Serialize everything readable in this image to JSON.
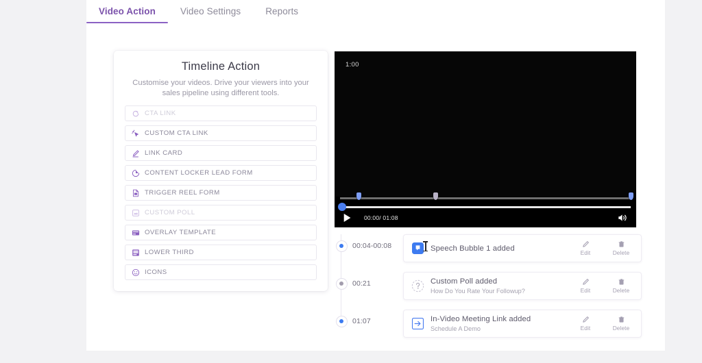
{
  "tabs": [
    {
      "label": "Video Action",
      "active": true
    },
    {
      "label": "Video Settings",
      "active": false
    },
    {
      "label": "Reports",
      "active": false
    }
  ],
  "timeline_card": {
    "title": "Timeline Action",
    "subtitle": "Customise your videos. Drive your viewers into your sales pipeline using different tools.",
    "actions": [
      {
        "label": "CTA LINK",
        "icon": "cta-link-icon",
        "dim": true
      },
      {
        "label": "CUSTOM CTA LINK",
        "icon": "custom-cta-link-icon",
        "dim": false
      },
      {
        "label": "LINK CARD",
        "icon": "link-card-icon",
        "dim": false
      },
      {
        "label": "CONTENT LOCKER LEAD FORM",
        "icon": "content-locker-icon",
        "dim": false
      },
      {
        "label": "TRIGGER REEL FORM",
        "icon": "trigger-reel-icon",
        "dim": false
      },
      {
        "label": "CUSTOM POLL",
        "icon": "custom-poll-icon",
        "dim": true
      },
      {
        "label": "OVERLAY TEMPLATE",
        "icon": "overlay-template-icon",
        "dim": false
      },
      {
        "label": "LOWER THIRD",
        "icon": "lower-third-icon",
        "dim": false
      },
      {
        "label": "ICONS",
        "icon": "icons-icon",
        "dim": false
      }
    ]
  },
  "player": {
    "overlay_timestamp": "1:00",
    "time_label": "00:00/ 01:08",
    "play_icon": "play-icon",
    "volume_icon": "volume-on-icon",
    "progress_percent": 0,
    "markers": [
      {
        "position_percent": 6.5,
        "muted": false
      },
      {
        "position_percent": 33.0,
        "muted": true
      },
      {
        "position_percent": 100.0,
        "muted": false
      }
    ]
  },
  "events": {
    "edit_label": "Edit",
    "delete_label": "Delete",
    "rows": [
      {
        "time": "00:04-00:08",
        "title": "Speech Bubble 1 added",
        "subtitle": "",
        "icon": "speech-bubble-icon",
        "dot_muted": false
      },
      {
        "time": "00:21",
        "title": "Custom Poll added",
        "subtitle": "How Do You Rate Your Followup?",
        "icon": "question-mark-icon",
        "dot_muted": true
      },
      {
        "time": "01:07",
        "title": "In-Video Meeting Link added",
        "subtitle": "Schedule A Demo",
        "icon": "arrow-into-box-icon",
        "dot_muted": false
      }
    ]
  },
  "colors": {
    "accent_purple": "#8b62c4",
    "accent_blue": "#3d7bf0",
    "page_background": "#f2f2f4",
    "panel_background": "#ffffff"
  }
}
